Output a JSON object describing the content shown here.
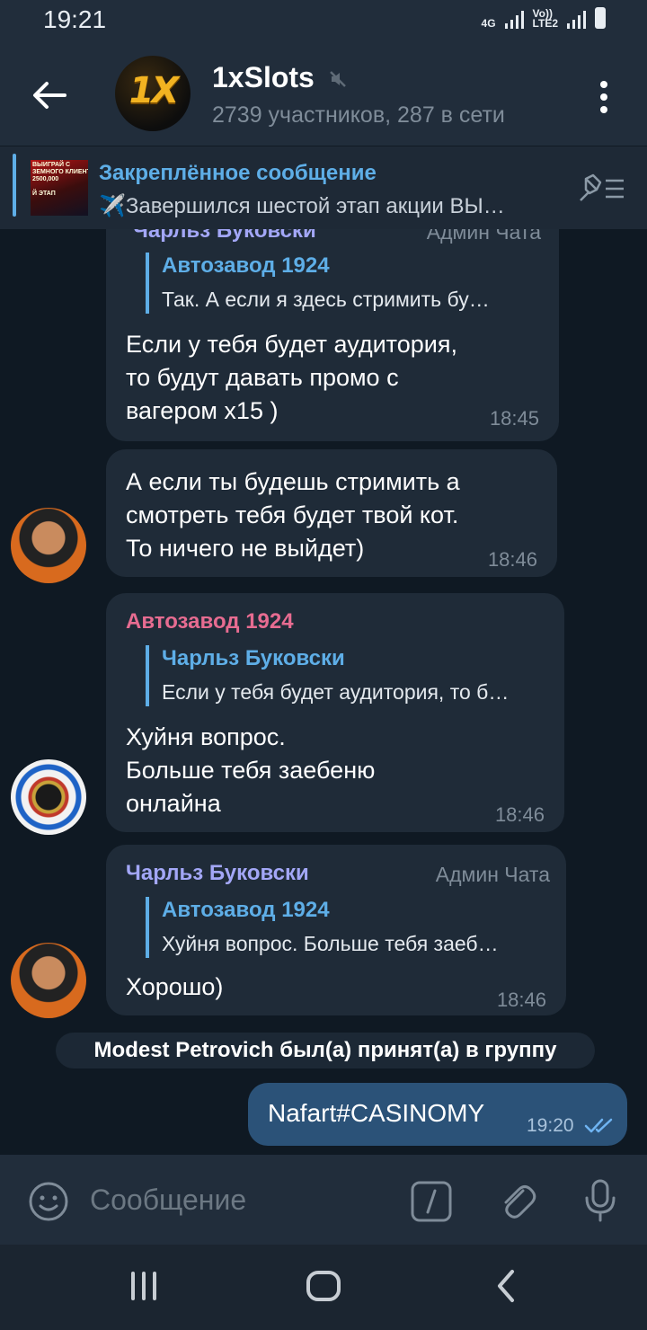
{
  "status": {
    "time": "19:21",
    "net1": "4G",
    "net2": "Vo))\nLTE2"
  },
  "header": {
    "logo_text": "1X",
    "title": "1xSlots",
    "subtitle": "2739 участников, 287 в сети"
  },
  "pinned": {
    "title": "Закреплённое сообщение",
    "text": "✈️Завершился шестой этап акции ВЫ…",
    "thumb_text": "ВЫИГРАЙ С\nЗЕМНОГО КЛИЕНТА\n2500,000\n\nЙ ЭТАП"
  },
  "messages": [
    {
      "sender": "Чарльз Буковски",
      "badge": "Админ Чата",
      "reply_name": "Автозавод 1924",
      "reply_text": "Так.  А если я здесь стримить бу…",
      "text": "Если у тебя будет аудитория,\nто будут давать промо с\nвагером x15 )",
      "time": "18:45"
    },
    {
      "text": "А если ты будешь стримить а\nсмотреть тебя будет твой кот.\nТо ничего не выйдет)",
      "time": "18:46"
    },
    {
      "sender": "Автозавод 1924",
      "reply_name": "Чарльз Буковски",
      "reply_text": "Если у тебя будет аудитория, то б…",
      "text": "Хуйня вопрос.\nБольше тебя заебеню\nонлайна",
      "time": "18:46"
    },
    {
      "sender": "Чарльз Буковски",
      "badge": "Админ Чата",
      "reply_name": "Автозавод 1924",
      "reply_text": "Хуйня вопрос.  Больше тебя заеб…",
      "text": "Хорошо)",
      "time": "18:46"
    }
  ],
  "service_message": "Modest Petrovich был(а) принят(а) в группу",
  "outgoing": {
    "text": "Nafart#CASINOMY",
    "time": "19:20"
  },
  "input": {
    "placeholder": "Сообщение"
  },
  "colors": {
    "accent": "#5eaee7",
    "bubble": "#1f2b38",
    "outgoing": "#2b5278",
    "sender_pink": "#e76c91",
    "sender_purple": "#a3a7f7"
  }
}
